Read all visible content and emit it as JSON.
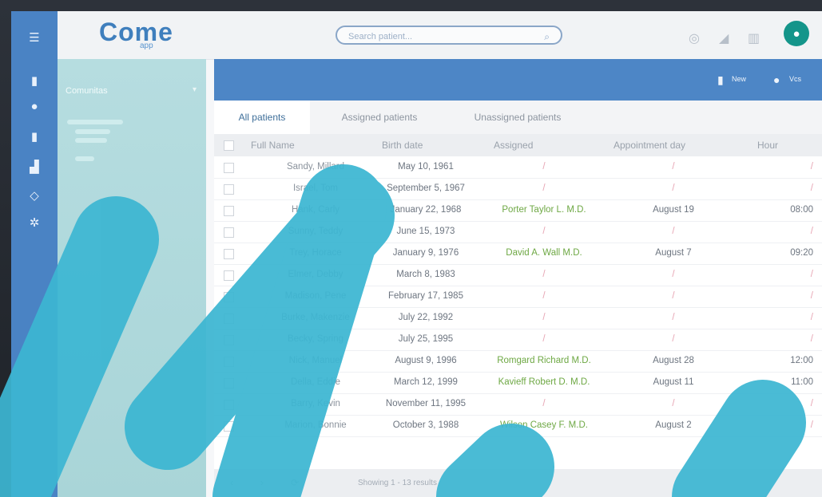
{
  "app": {
    "logo": "Come",
    "logo_sub": "app"
  },
  "search": {
    "placeholder": "Search patient..."
  },
  "groups": {
    "title": "Comunitas"
  },
  "toolbar": {
    "new_label": "New",
    "user_label": "Vcs"
  },
  "tabs": [
    {
      "label": "All patients",
      "active": true
    },
    {
      "label": "Assigned patients",
      "active": false
    },
    {
      "label": "Unassigned patients",
      "active": false
    }
  ],
  "table": {
    "columns": [
      "Full Name",
      "Birth date",
      "Assigned",
      "Appointment day",
      "Hour"
    ],
    "rows": [
      {
        "name": "Sandy, Millard",
        "birth": "May 10, 1961",
        "assigned": "/",
        "day": "/",
        "hour": "/"
      },
      {
        "name": "Israel, Tom",
        "birth": "September 5, 1967",
        "assigned": "/",
        "day": "/",
        "hour": "/"
      },
      {
        "name": "Hank, Carly",
        "birth": "January 22, 1968",
        "assigned": "Porter Taylor L. M.D.",
        "day": "August 19",
        "hour": "08:00"
      },
      {
        "name": "Sunny, Teddy",
        "birth": "June 15, 1973",
        "assigned": "/",
        "day": "/",
        "hour": "/"
      },
      {
        "name": "Trey, Horace",
        "birth": "January 9, 1976",
        "assigned": "David A. Wall M.D.",
        "day": "August 7",
        "hour": "09:20"
      },
      {
        "name": "Elmer, Debby",
        "birth": "March 8, 1983",
        "assigned": "/",
        "day": "/",
        "hour": "/"
      },
      {
        "name": "Madison, Pene",
        "birth": "February 17, 1985",
        "assigned": "/",
        "day": "/",
        "hour": "/"
      },
      {
        "name": "Burke, Makenzie",
        "birth": "July 22, 1992",
        "assigned": "/",
        "day": "/",
        "hour": "/"
      },
      {
        "name": "Becky, Spring",
        "birth": "July 25, 1995",
        "assigned": "/",
        "day": "/",
        "hour": "/"
      },
      {
        "name": "Nick, Manuel",
        "birth": "August 9, 1996",
        "assigned": "Romgard Richard M.D.",
        "day": "August 28",
        "hour": "12:00"
      },
      {
        "name": "Della, Eddie",
        "birth": "March 12, 1999",
        "assigned": "Kavieff Robert D. M.D.",
        "day": "August 11",
        "hour": "11:00"
      },
      {
        "name": "Barry, Kevin",
        "birth": "November 11, 1995",
        "assigned": "/",
        "day": "/",
        "hour": "/"
      },
      {
        "name": "Marion, Bonnie",
        "birth": "October 3, 1988",
        "assigned": "Wilson Casey F. M.D.",
        "day": "August 2",
        "hour": "/"
      }
    ]
  },
  "footer": {
    "paging": "Showing 1 - 13 results"
  },
  "colors": {
    "rail": "#4a83c4",
    "accent": "#4d86c6",
    "ribbon": "#3cb6d2",
    "assigned_text": "#6ea844"
  }
}
